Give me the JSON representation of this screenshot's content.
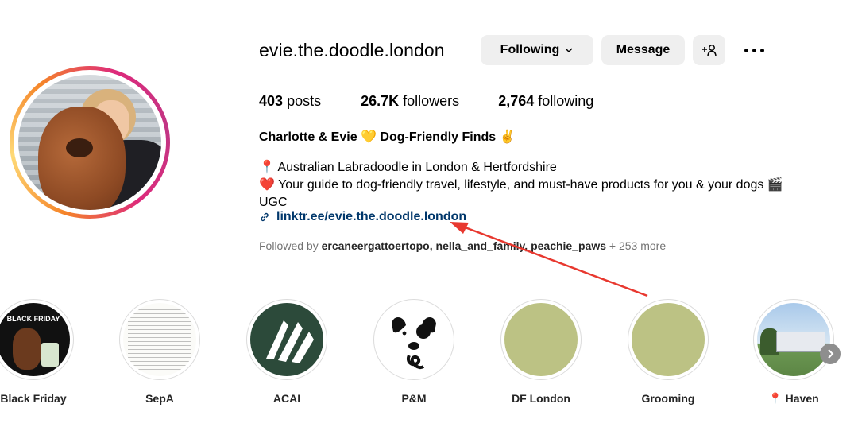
{
  "profile": {
    "username": "evie.the.doodle.london",
    "following_label": "Following",
    "message_label": "Message",
    "stats": {
      "posts_count": "403",
      "posts_label": "posts",
      "followers_count": "26.7K",
      "followers_label": "followers",
      "following_count": "2,764",
      "following_label": "following"
    },
    "full_name": "Charlotte & Evie 💛 Dog-Friendly Finds ✌️",
    "bio_line1": "📍 Australian Labradoodle in London & Hertfordshire",
    "bio_line2": "❤️ Your guide to dog-friendly travel, lifestyle, and must-have products for you & your dogs 🎬",
    "bio_line3": "UGC",
    "link_text": "linktr.ee/evie.the.doodle.london",
    "followed_by_prefix": "Followed by ",
    "followed_by_names": "ercaneergattoertopo, nella_and_family, peachie_paws",
    "followed_by_suffix": " + 253 more"
  },
  "highlights": [
    {
      "label": "Black Friday",
      "image_text": "BLACK FRIDAY"
    },
    {
      "label": "SepA"
    },
    {
      "label": "ACAI"
    },
    {
      "label": "P&M"
    },
    {
      "label": "DF London"
    },
    {
      "label": "Grooming"
    },
    {
      "label": "📍 Haven"
    }
  ],
  "icons": {
    "add_user": "add-user-icon",
    "more": "more-options-icon",
    "link": "link-icon",
    "next": "chevron-right-icon"
  },
  "colors": {
    "link": "#00376b",
    "button_bg": "#efefef",
    "annotation_arrow": "#e8382f",
    "olive_highlight": "#bcc284",
    "acai_green": "#2c4a3a"
  }
}
